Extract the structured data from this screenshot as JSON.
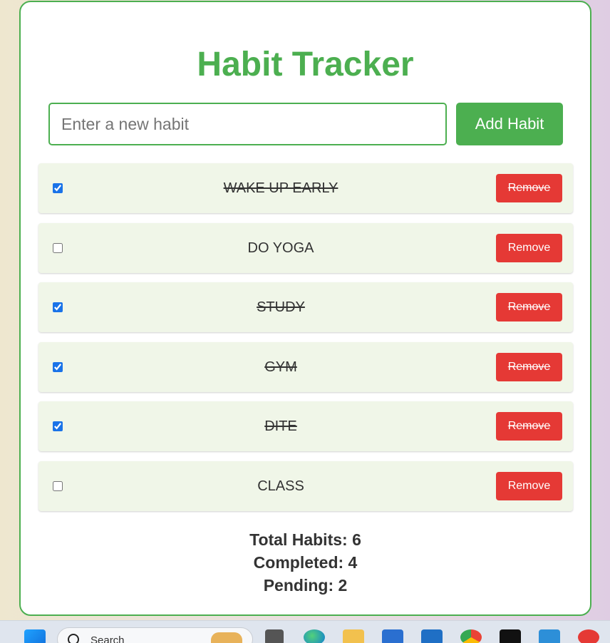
{
  "app": {
    "title": "Habit Tracker",
    "input_placeholder": "Enter a new habit",
    "input_value": "",
    "add_button_label": "Add Habit"
  },
  "habits": [
    {
      "name": "WAKE UP EARLY",
      "done": true,
      "remove_label": "Remove"
    },
    {
      "name": "DO YOGA",
      "done": false,
      "remove_label": "Remove"
    },
    {
      "name": "STUDY",
      "done": true,
      "remove_label": "Remove"
    },
    {
      "name": "GYM",
      "done": true,
      "remove_label": "Remove"
    },
    {
      "name": "DITE",
      "done": true,
      "remove_label": "Remove"
    },
    {
      "name": "CLASS",
      "done": false,
      "remove_label": "Remove"
    }
  ],
  "stats": {
    "total": "Total Habits: 6",
    "completed": "Completed: 4",
    "pending": "Pending: 2"
  },
  "taskbar": {
    "search_text": "Search",
    "icons": [
      "windows-start-icon",
      "search-icon",
      "task-view-icon",
      "edge-icon",
      "file-explorer-icon",
      "store-icon",
      "outlook-icon",
      "chrome-icon",
      "capcut-icon",
      "vscode-icon",
      "tomato-icon"
    ]
  },
  "colors": {
    "accent": "#4caf50",
    "danger": "#e53935",
    "row_bg": "#f0f6e8"
  }
}
